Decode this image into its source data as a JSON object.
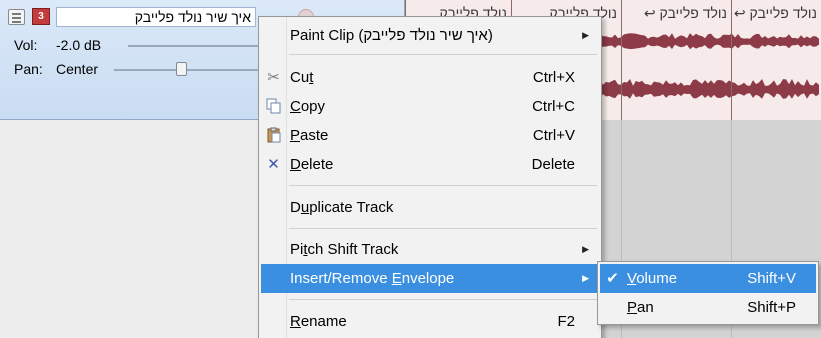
{
  "track": {
    "name": "איך שיר נולד פלייבק",
    "number": "3",
    "vol_label": "Vol:",
    "vol_value": "-2.0 dB",
    "pan_label": "Pan:",
    "pan_value": "Center"
  },
  "timeline": {
    "clips": [
      "נולד פלייבק",
      "נולד פלייבק",
      "נולד פלייבק ↩",
      "נולד פלייבק ↩"
    ]
  },
  "context_menu": {
    "items": [
      {
        "label": "Paint Clip (איך שיר נולד פלייבק)",
        "submenu": true
      },
      {
        "label": "Cut",
        "shortcut": "Ctrl+X",
        "icon": "scissors-icon"
      },
      {
        "label": "Copy",
        "shortcut": "Ctrl+C",
        "icon": "copy-icon"
      },
      {
        "label": "Paste",
        "shortcut": "Ctrl+V",
        "icon": "paste-icon"
      },
      {
        "label": "Delete",
        "shortcut": "Delete",
        "icon": "delete-icon"
      },
      {
        "label": "Duplicate Track"
      },
      {
        "label": "Pitch Shift Track",
        "submenu": true
      },
      {
        "label": "Insert/Remove Envelope",
        "submenu": true,
        "highlighted": true
      },
      {
        "label": "Rename",
        "shortcut": "F2"
      }
    ]
  },
  "envelope_submenu": {
    "items": [
      {
        "label": "Volume",
        "shortcut": "Shift+V",
        "checked": true,
        "highlighted": true
      },
      {
        "label": "Pan",
        "shortcut": "Shift+P",
        "checked": false
      }
    ]
  },
  "colors": {
    "highlight": "#3b8fe0",
    "waveform": "#8c3b47",
    "track_header": "#d2e3f6"
  }
}
